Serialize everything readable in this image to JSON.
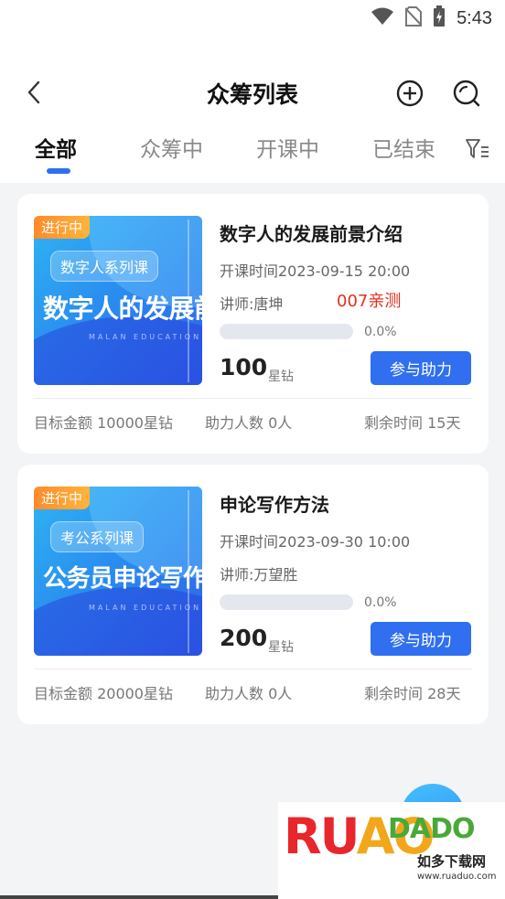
{
  "status_bar": {
    "time": "5:43"
  },
  "header": {
    "title": "众筹列表"
  },
  "tabs": [
    {
      "label": "全部",
      "active": true
    },
    {
      "label": "众筹中",
      "active": false
    },
    {
      "label": "开课中",
      "active": false
    },
    {
      "label": "已结束",
      "active": false
    }
  ],
  "cards": [
    {
      "badge": "进行中",
      "series": "数字人系列课",
      "thumb_title": "数字人的发展前景",
      "thumb_sub": "MALAN   EDUCATION",
      "title": "数字人的发展前景介绍",
      "time": "开课时间2023-09-15 20:00",
      "teacher": "讲师:唐坤",
      "tag": "007亲测",
      "progress": 0.0,
      "progress_text": "0.0%",
      "price": "100",
      "price_unit": "星钻",
      "button": "参与助力",
      "target": "目标金额 10000星钻",
      "helpers": "助力人数 0人",
      "remaining": "剩余时间 15天"
    },
    {
      "badge": "进行中",
      "series": "考公系列课",
      "thumb_title": "公务员申论写作",
      "thumb_sub": "MALAN   EDUCATION",
      "title": "申论写作方法",
      "time": "开课时间2023-09-30 10:00",
      "teacher": "讲师:万望胜",
      "tag": "",
      "progress": 0.0,
      "progress_text": "0.0%",
      "price": "200",
      "price_unit": "星钻",
      "button": "参与助力",
      "target": "目标金额 20000星钻",
      "helpers": "助力人数 0人",
      "remaining": "剩余时间 28天"
    }
  ],
  "watermark": {
    "logo_r": "RU",
    "logo_o": "AO",
    "logo_rest": "DADO",
    "cn": "如多下载网",
    "url": "www.ruaduo.com"
  },
  "colors": {
    "accent": "#2f6ff0",
    "tag_red": "#e53020",
    "badge_orange": "#ff8a2a"
  }
}
